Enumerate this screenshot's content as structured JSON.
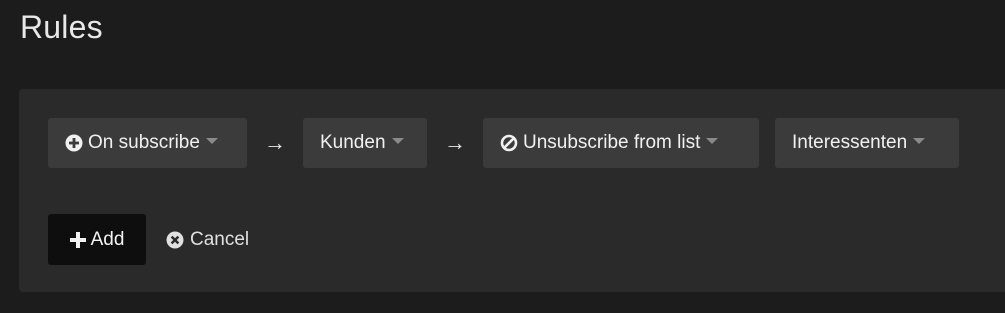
{
  "page": {
    "title": "Rules"
  },
  "rule": {
    "trigger": {
      "label": "On subscribe",
      "icon": "plus-circle-icon"
    },
    "arrow_symbol": "→",
    "list": {
      "label": "Kunden"
    },
    "action": {
      "label": "Unsubscribe from list",
      "icon": "ban-icon"
    },
    "target_list": {
      "label": "Interessenten"
    }
  },
  "actions": {
    "add_label": "Add",
    "add_icon": "plus-icon",
    "cancel_label": "Cancel",
    "cancel_icon": "times-circle-icon"
  },
  "colors": {
    "background": "#1c1c1c",
    "panel": "#2a2a2a",
    "dropdown": "#3b3b3b",
    "add_button": "#0e0e0e",
    "text": "#f0f0f0",
    "caret": "#8a8a8a"
  }
}
